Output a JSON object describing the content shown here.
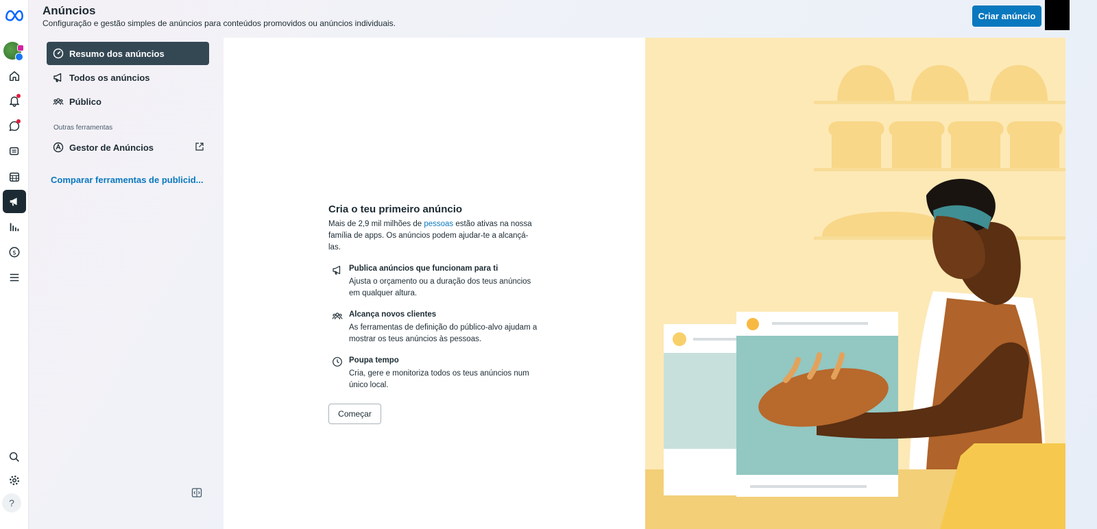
{
  "header": {
    "title": "Anúncios",
    "subtitle": "Configuração e gestão simples de anúncios para conteúdos promovidos ou anúncios individuais.",
    "create_button": "Criar anúncio"
  },
  "rail": {
    "icons": [
      "meta-logo-icon",
      "home-icon",
      "bell-icon",
      "chat-icon",
      "content-icon",
      "calendar-icon",
      "megaphone-icon",
      "insights-icon",
      "dollar-icon",
      "menu-icon",
      "search-icon",
      "gear-icon",
      "help-icon"
    ]
  },
  "nav": {
    "items": [
      {
        "label": "Resumo dos anúncios",
        "icon": "dashboard-icon"
      },
      {
        "label": "Todos os anúncios",
        "icon": "megaphone-icon"
      },
      {
        "label": "Público",
        "icon": "people-icon"
      }
    ],
    "section_label": "Outras ferramentas",
    "tools": [
      {
        "label": "Gestor de Anúncios",
        "icon": "ads-manager-icon"
      }
    ],
    "compare_link": "Comparar ferramentas de publicid..."
  },
  "main": {
    "title": "Cria o teu primeiro anúncio",
    "desc_before": "Mais de 2,9 mil milhões de ",
    "desc_link": "pessoas",
    "desc_after": " estão ativas na nossa família de apps. Os anúncios podem ajudar-te a alcançá-las.",
    "features": [
      {
        "title": "Publica anúncios que funcionam para ti",
        "text": "Ajusta o orçamento ou a duração dos teus anúncios em qualquer altura."
      },
      {
        "title": "Alcança novos clientes",
        "text": "As ferramentas de definição do público-alvo ajudam a mostrar os teus anúncios às pessoas."
      },
      {
        "title": "Poupa tempo",
        "text": "Cria, gere e monitoriza todos os teus anúncios num único local."
      }
    ],
    "start_button": "Começar"
  },
  "colors": {
    "accent": "#0a78be",
    "nav_active": "#344854",
    "rail_active": "#1c2b33"
  }
}
